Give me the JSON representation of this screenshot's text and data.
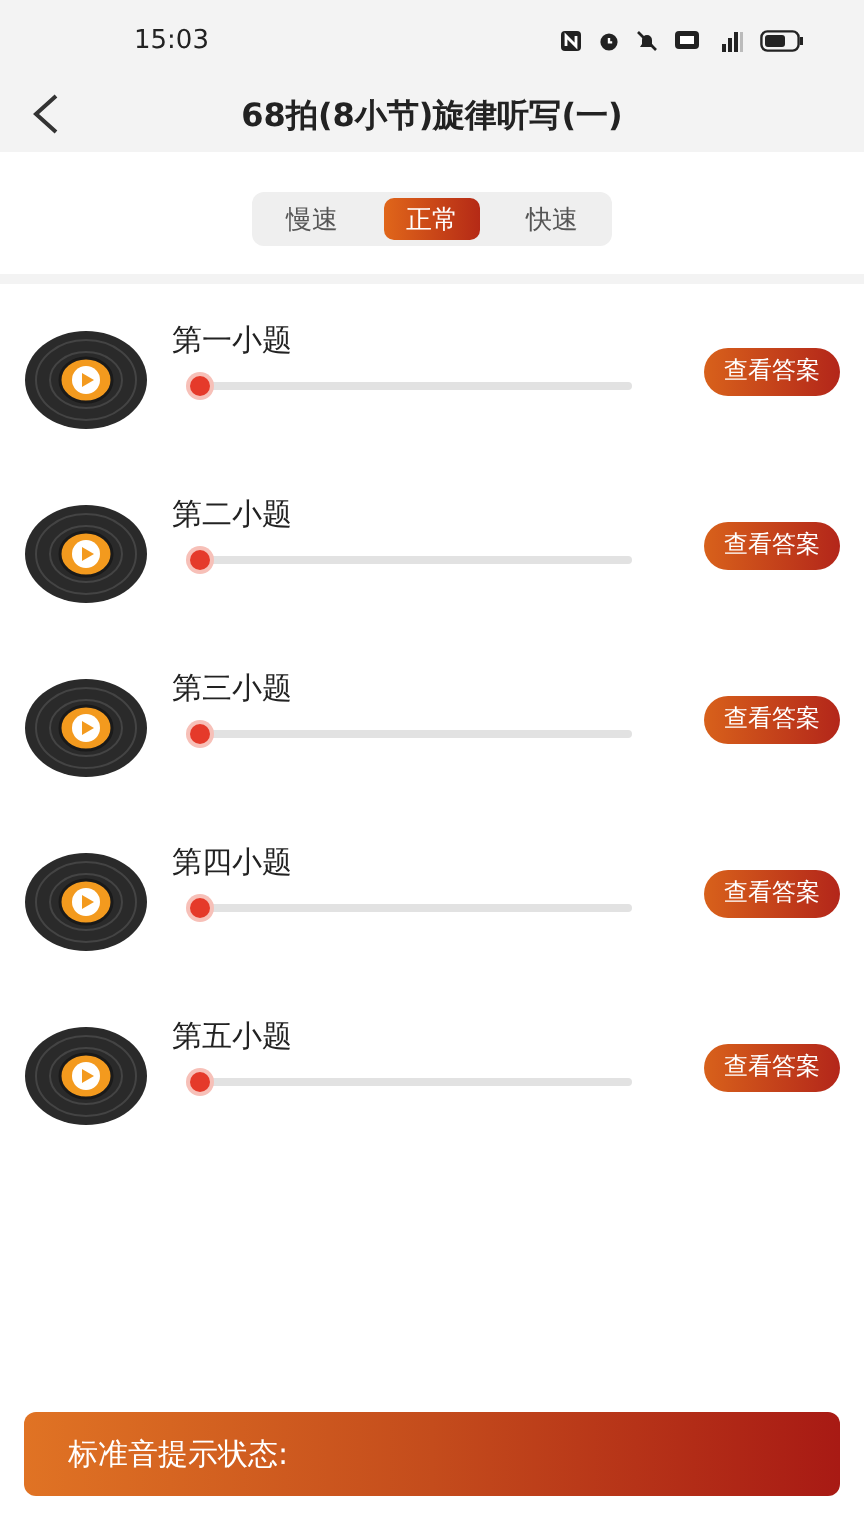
{
  "status_bar": {
    "time": "15:03"
  },
  "header": {
    "title": "68拍(8小节)旋律听写(一)"
  },
  "speed_tabs": [
    {
      "label": "慢速",
      "selected": false
    },
    {
      "label": "正常",
      "selected": true
    },
    {
      "label": "快速",
      "selected": false
    }
  ],
  "questions": [
    {
      "title": "第一小题",
      "level": 0,
      "button": "查看答案"
    },
    {
      "title": "第二小题",
      "level": 0,
      "button": "查看答案"
    },
    {
      "title": "第三小题",
      "level": 0,
      "button": "查看答案"
    },
    {
      "title": "第四小题",
      "level": 0,
      "button": "查看答案"
    },
    {
      "title": "第五小题",
      "level": 0,
      "button": "查看答案"
    }
  ],
  "bottom_bar": {
    "label": "标准音提示状态:"
  }
}
